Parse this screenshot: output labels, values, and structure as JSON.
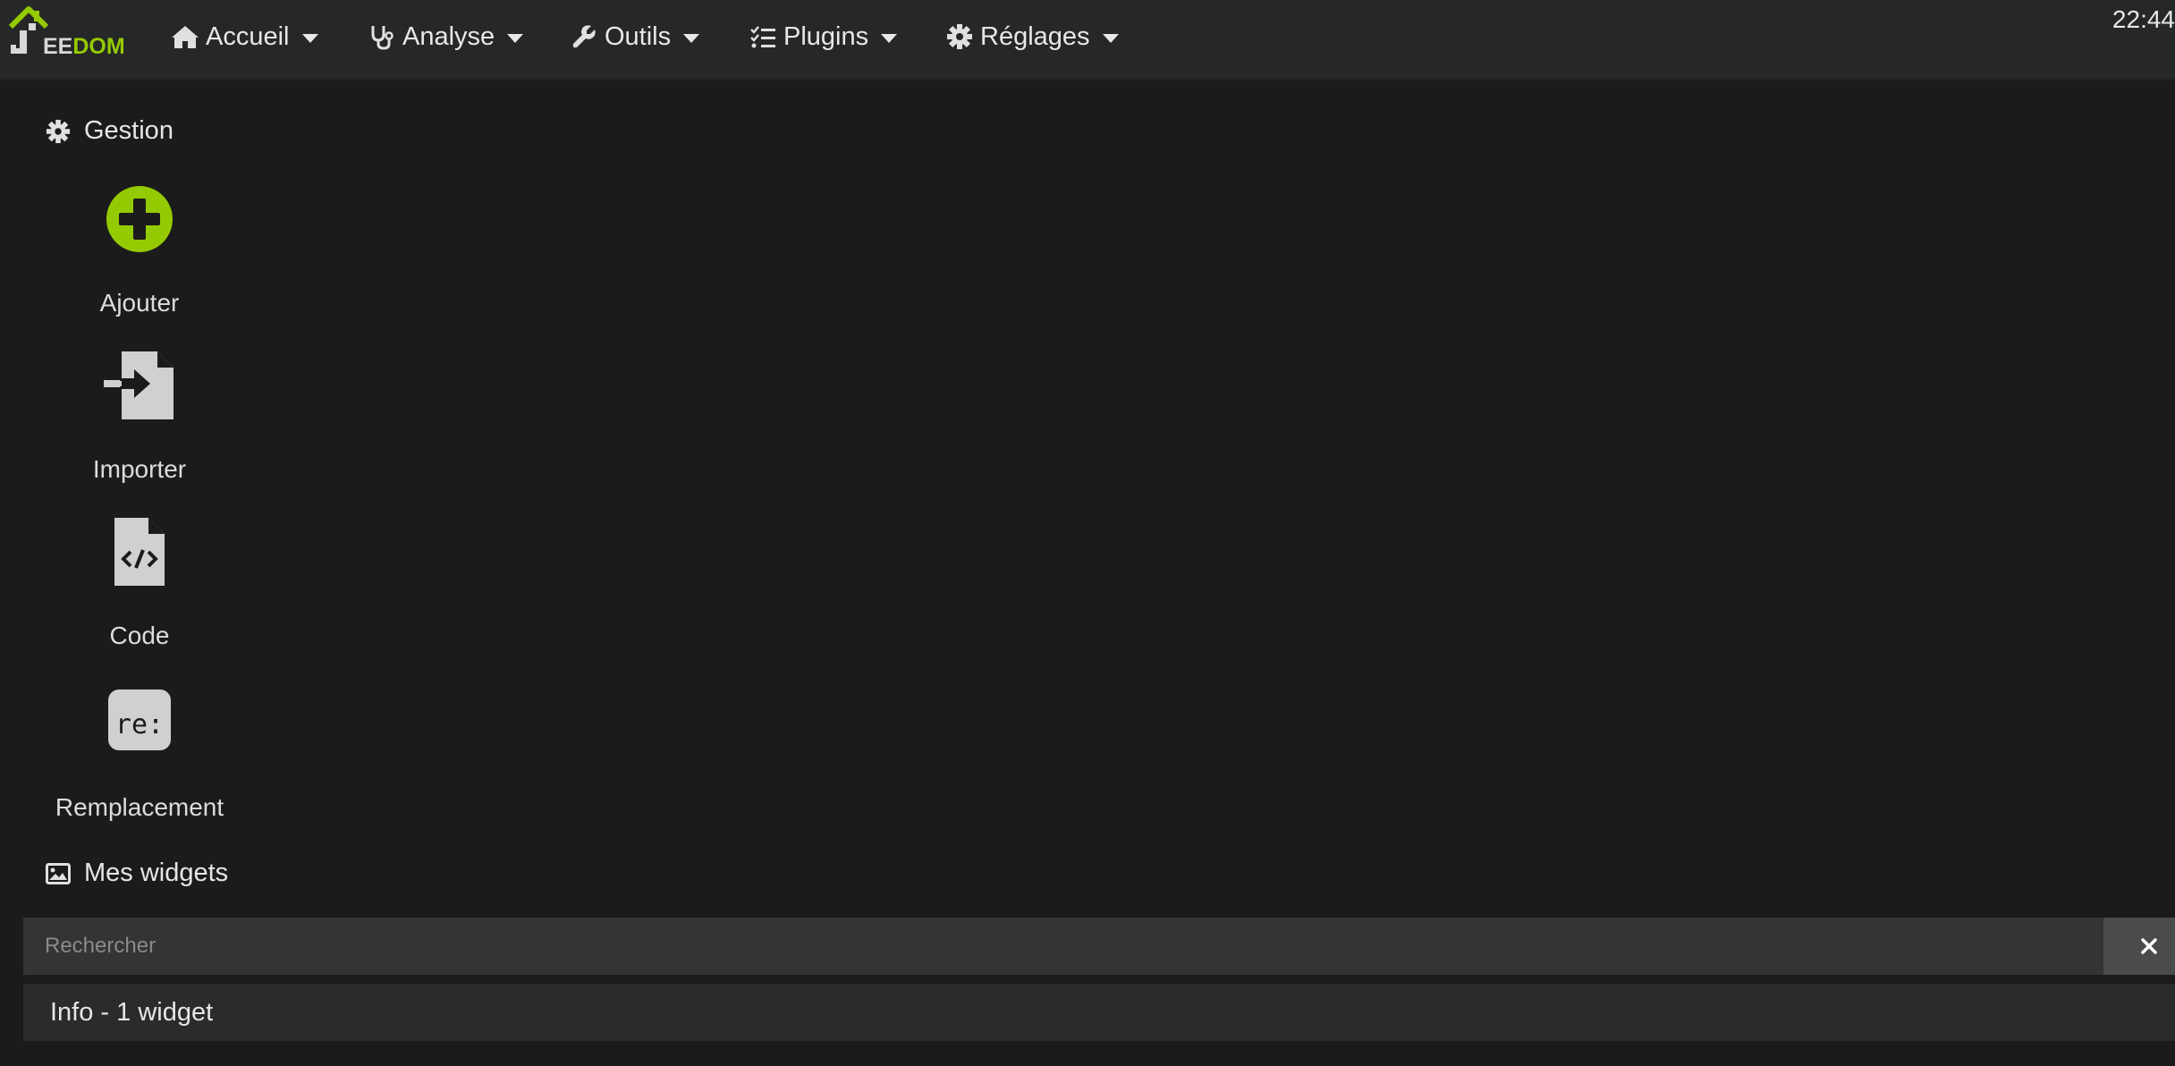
{
  "app": {
    "logo_text": "JEEDOM",
    "clock": "22:44"
  },
  "nav": [
    {
      "label": "Accueil",
      "icon": "home-icon"
    },
    {
      "label": "Analyse",
      "icon": "stethoscope-icon"
    },
    {
      "label": "Outils",
      "icon": "wrench-icon"
    },
    {
      "label": "Plugins",
      "icon": "tasks-list-icon"
    },
    {
      "label": "Réglages",
      "icon": "gear-icon"
    }
  ],
  "gestion": {
    "title": "Gestion",
    "actions": [
      {
        "label": "Ajouter",
        "icon": "plus-circle-icon"
      },
      {
        "label": "Importer",
        "icon": "file-import-icon"
      },
      {
        "label": "Code",
        "icon": "file-code-icon"
      },
      {
        "label": "Remplacement",
        "icon": "regex-icon",
        "icon_text": "re:"
      }
    ]
  },
  "widgets": {
    "title": "Mes widgets",
    "search_placeholder": "Rechercher",
    "groups": [
      {
        "label": "Info - 1 widget"
      }
    ]
  },
  "colors": {
    "accent": "#94ca02",
    "background": "#1b1b1b",
    "topbar": "#262727",
    "icon_grey": "#d0d0d0"
  }
}
